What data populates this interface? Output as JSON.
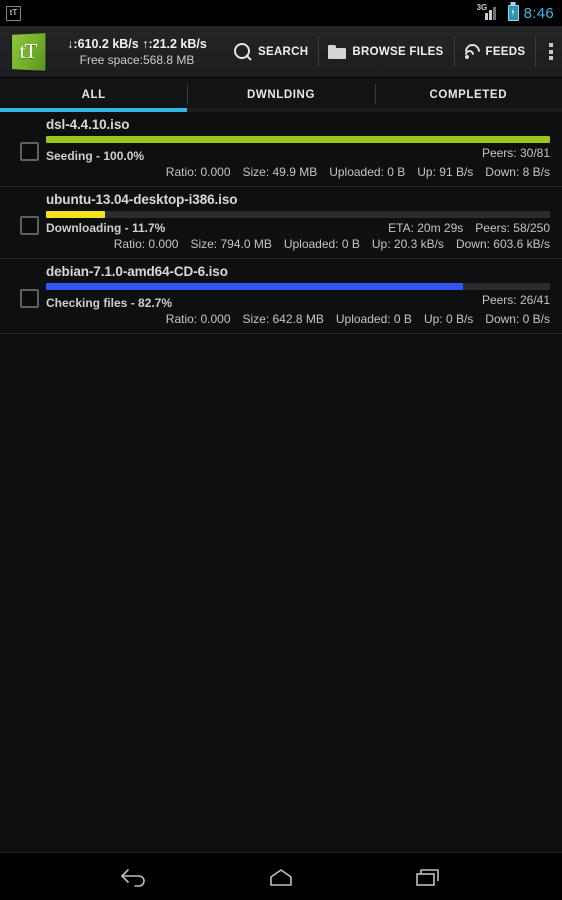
{
  "statusbar": {
    "notification_icon": "ttorrent-notification-icon",
    "network_type": "3G",
    "signal_icon": "signal-bars-icon",
    "battery_icon": "battery-charging-icon",
    "clock": "8:46",
    "clock_color": "#41b6e6"
  },
  "actionbar": {
    "logo": "ttorrent-logo",
    "logo_text": "tT",
    "speed_line": "↓:610.2 kB/s ↑:21.2 kB/s",
    "free_space_line": "Free space:568.8 MB",
    "items": [
      {
        "label": "SEARCH",
        "icon": "search-icon"
      },
      {
        "label": "BROWSE FILES",
        "icon": "folder-icon"
      },
      {
        "label": "FEEDS",
        "icon": "rss-icon"
      }
    ],
    "overflow_icon": "overflow-menu-icon"
  },
  "tabs": {
    "active_index": 0,
    "indicator_color": "#33b5e5",
    "items": [
      {
        "label": "ALL"
      },
      {
        "label": "DWNLDING"
      },
      {
        "label": "COMPLETED"
      }
    ]
  },
  "torrents": [
    {
      "name": "dsl-4.4.10.iso",
      "status": "Seeding - 100.0%",
      "progress_percent": 100,
      "progress_color": "#9ac61c",
      "eta": "",
      "peers": "Peers: 30/81",
      "ratio": "Ratio: 0.000",
      "size": "Size: 49.9 MB",
      "uploaded": "Uploaded: 0 B",
      "up": "Up: 91 B/s",
      "down": "Down: 8 B/s"
    },
    {
      "name": "ubuntu-13.04-desktop-i386.iso",
      "status": "Downloading - 11.7%",
      "progress_percent": 11.7,
      "progress_color": "#f2e31c",
      "eta": "ETA: 20m 29s",
      "peers": "Peers: 58/250",
      "ratio": "Ratio: 0.000",
      "size": "Size: 794.0 MB",
      "uploaded": "Uploaded: 0 B",
      "up": "Up: 20.3 kB/s",
      "down": "Down: 603.6 kB/s"
    },
    {
      "name": "debian-7.1.0-amd64-CD-6.iso",
      "status": "Checking files - 82.7%",
      "progress_percent": 82.7,
      "progress_color": "#3355f5",
      "eta": "",
      "peers": "Peers: 26/41",
      "ratio": "Ratio: 0.000",
      "size": "Size: 642.8 MB",
      "uploaded": "Uploaded: 0 B",
      "up": "Up: 0 B/s",
      "down": "Down: 0 B/s"
    }
  ],
  "navbar": {
    "back_icon": "back-icon",
    "home_icon": "home-icon",
    "recents_icon": "recents-icon"
  }
}
